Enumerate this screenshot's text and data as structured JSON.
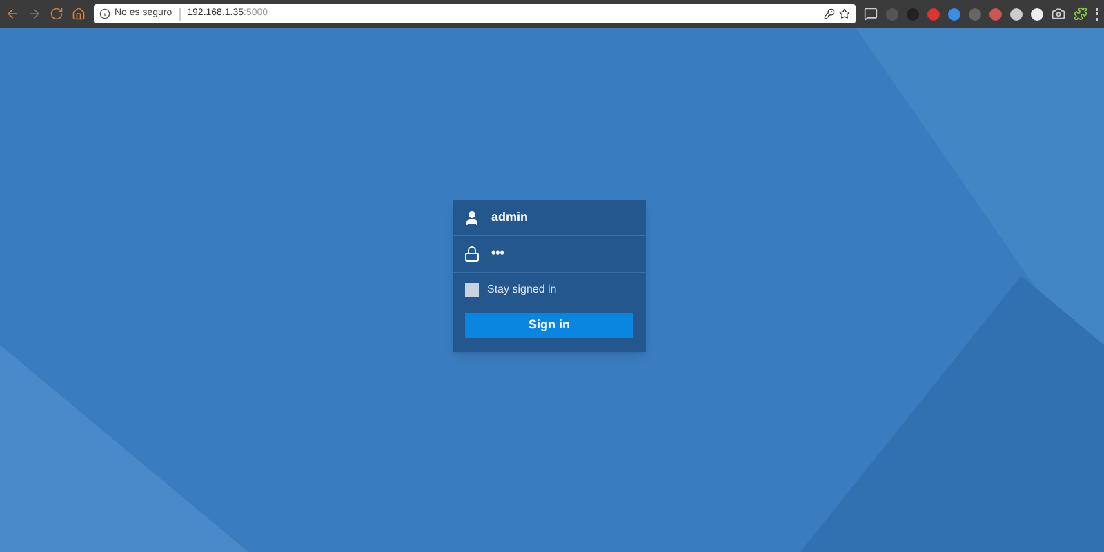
{
  "browser": {
    "security_label": "No es seguro",
    "url_host": "192.168.1.35",
    "url_port": ":5000"
  },
  "login": {
    "username": "admin",
    "password": "•••",
    "stay_signed_in": {
      "label": "Stay signed in",
      "checked": false
    },
    "submit": "Sign in"
  }
}
